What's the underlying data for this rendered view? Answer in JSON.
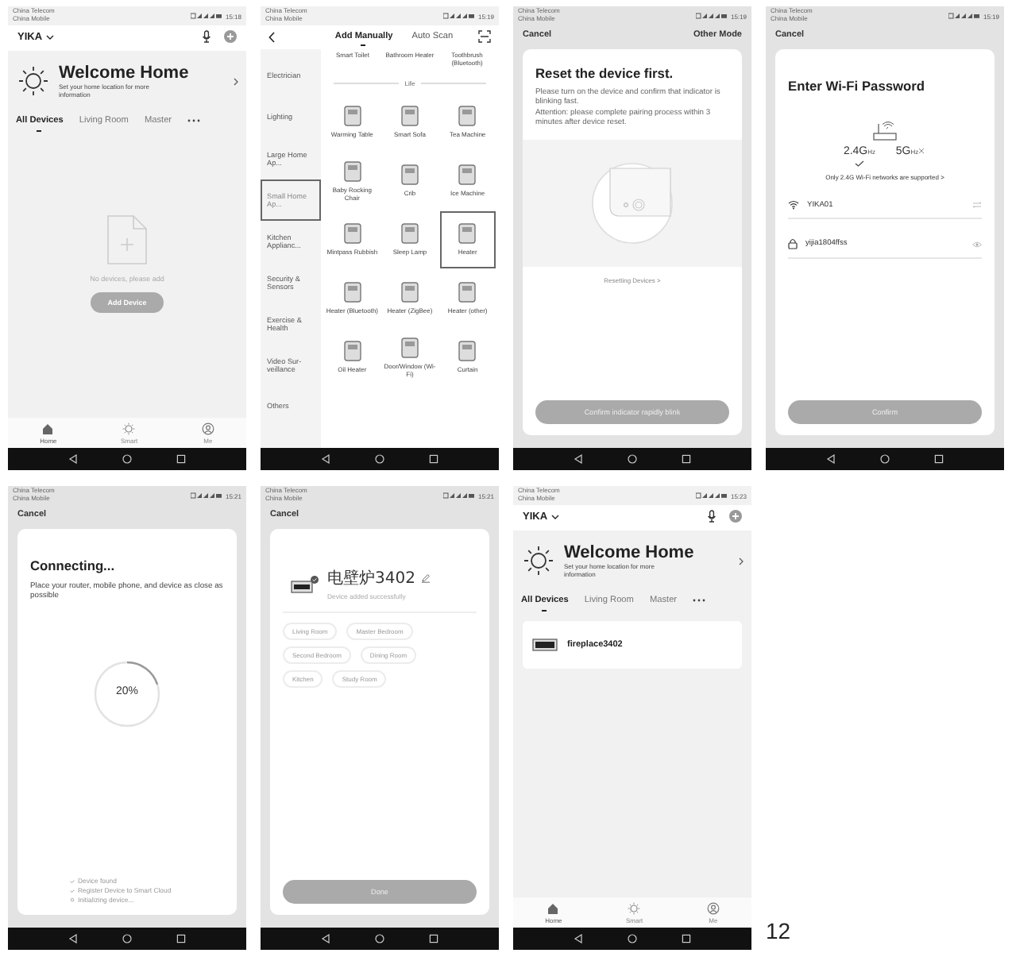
{
  "screens": [
    {
      "kind": "home",
      "status": {
        "carrier_1": "China Telecom",
        "carrier_2": "China Mobile",
        "time": "15:18"
      },
      "home_name": "YIKA",
      "welcome": {
        "title": "Welcome Home",
        "subtitle": "Set your home location for more information"
      },
      "tabs": [
        {
          "label": "All Devices",
          "selected": true
        },
        {
          "label": "Living Room",
          "selected": false
        },
        {
          "label": "Master",
          "selected": false
        }
      ],
      "empty": {
        "message": "No devices, please add",
        "button": "Add Device"
      },
      "bottom_tabs": [
        {
          "label": "Home",
          "selected": true
        },
        {
          "label": "Smart",
          "selected": false
        },
        {
          "label": "Me",
          "selected": false
        }
      ]
    },
    {
      "kind": "add_manually",
      "status": {
        "carrier_1": "China Telecom",
        "carrier_2": "China Mobile",
        "time": "15:19"
      },
      "tabs": [
        {
          "label": "Add Manually",
          "selected": true
        },
        {
          "label": "Auto Scan",
          "selected": false
        }
      ],
      "categories": [
        {
          "label": "Electrician",
          "selected": false
        },
        {
          "label": "Lighting",
          "selected": false
        },
        {
          "label": "Large Home Ap...",
          "selected": false
        },
        {
          "label": "Small Home Ap...",
          "selected": true
        },
        {
          "label": "Kitchen Applianc...",
          "selected": false
        },
        {
          "label": "Security & Sensors",
          "selected": false
        },
        {
          "label": "Exercise & Health",
          "selected": false
        },
        {
          "label": "Video Sur-veillance",
          "selected": false
        },
        {
          "label": "Others",
          "selected": false
        }
      ],
      "top_items": [
        "Smart Toilet",
        "Bathroom Heater",
        "Toothbrush (Bluetooth)"
      ],
      "section": "Life",
      "items": [
        {
          "label": "Warming Table",
          "selected": false
        },
        {
          "label": "Smart Sofa",
          "selected": false
        },
        {
          "label": "Tea Machine",
          "selected": false
        },
        {
          "label": "Baby Rocking Chair",
          "selected": false
        },
        {
          "label": "Crib",
          "selected": false
        },
        {
          "label": "Ice Machine",
          "selected": false
        },
        {
          "label": "Mintpass Rubbish",
          "selected": false
        },
        {
          "label": "Sleep Lamp",
          "selected": false
        },
        {
          "label": "Heater",
          "selected": true
        },
        {
          "label": "Heater (Bluetooth)",
          "selected": false
        },
        {
          "label": "Heater (ZigBee)",
          "selected": false
        },
        {
          "label": "Heater (other)",
          "selected": false
        },
        {
          "label": "Oil Heater",
          "selected": false
        },
        {
          "label": "Door/Window (Wi-Fi)",
          "selected": false
        },
        {
          "label": "Curtain",
          "selected": false
        }
      ]
    },
    {
      "kind": "reset",
      "status": {
        "carrier_1": "China Telecom",
        "carrier_2": "China Mobile",
        "time": "15:19"
      },
      "cancel": "Cancel",
      "other_mode": "Other Mode",
      "title": "Reset the device first.",
      "paragraphs": [
        "Please turn on the device and confirm that indicator is blinking fast.",
        "Attention: please complete pairing process within 3 minutes after device reset."
      ],
      "link": "Resetting Devices >",
      "button": "Confirm indicator rapidly blink"
    },
    {
      "kind": "wifi",
      "status": {
        "carrier_1": "China Telecom",
        "carrier_2": "China Mobile",
        "time": "15:19"
      },
      "cancel": "Cancel",
      "title": "Enter Wi-Fi Password",
      "bands": [
        {
          "value": "2.4G",
          "unit": "Hz",
          "supported": true
        },
        {
          "value": "5G",
          "unit": "Hz",
          "supported": false
        }
      ],
      "note": "Only 2.4G Wi-Fi networks are supported >",
      "network": "YIKA01",
      "password": "yijia1804ffss",
      "button": "Confirm"
    },
    {
      "kind": "connecting",
      "status": {
        "carrier_1": "China Telecom",
        "carrier_2": "China Mobile",
        "time": "15:21"
      },
      "cancel": "Cancel",
      "title": "Connecting...",
      "text": "Place your router, mobile phone, and device as close as possible",
      "progress": {
        "level": 0.2,
        "label": "20%"
      },
      "steps": [
        {
          "label": "Device found",
          "done": true
        },
        {
          "label": "Register Device to Smart Cloud",
          "done": true
        },
        {
          "label": "Initializing device...",
          "done": false
        }
      ]
    },
    {
      "kind": "added",
      "status": {
        "carrier_1": "China Telecom",
        "carrier_2": "China Mobile",
        "time": "15:21"
      },
      "cancel": "Cancel",
      "device": {
        "name": "电壁炉3402",
        "message": "Device added successfully"
      },
      "rooms": [
        {
          "label": "Living Room",
          "selected": false
        },
        {
          "label": "Master Bedroom",
          "selected": false
        },
        {
          "label": "Second Bedroom",
          "selected": false
        },
        {
          "label": "Dining Room",
          "selected": false
        },
        {
          "label": "Kitchen",
          "selected": false
        },
        {
          "label": "Study Room",
          "selected": false
        }
      ],
      "button": "Done"
    },
    {
      "kind": "home",
      "status": {
        "carrier_1": "China Telecom",
        "carrier_2": "China Mobile",
        "time": "15:23"
      },
      "home_name": "YIKA",
      "welcome": {
        "title": "Welcome Home",
        "subtitle": "Set your home location for more information"
      },
      "tabs": [
        {
          "label": "All Devices",
          "selected": true
        },
        {
          "label": "Living Room",
          "selected": false
        },
        {
          "label": "Master",
          "selected": false
        }
      ],
      "devices": [
        {
          "name": "fireplace3402"
        }
      ],
      "bottom_tabs": [
        {
          "label": "Home",
          "selected": true
        },
        {
          "label": "Smart",
          "selected": false
        },
        {
          "label": "Me",
          "selected": false
        }
      ]
    }
  ],
  "page_number": "12"
}
